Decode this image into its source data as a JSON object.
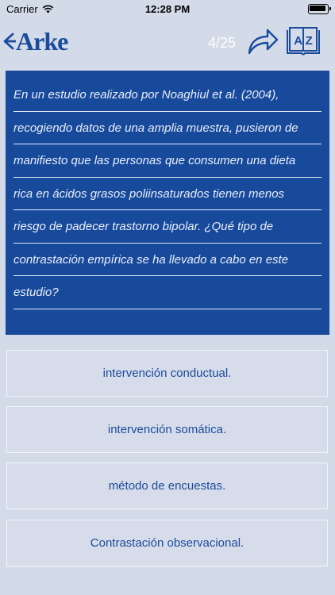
{
  "status_bar": {
    "carrier": "Carrier",
    "time": "12:28 PM"
  },
  "header": {
    "logo_text": "Arke",
    "counter": "4/25",
    "dictionary_icon_text": "A Z"
  },
  "question": {
    "lines": [
      "En un estudio realizado por Noaghiul et al. (2004),",
      "recogiendo datos de una amplia muestra, pusieron de",
      "manifiesto que las personas que consumen una dieta",
      "rica en ácidos grasos poliinsaturados tienen menos",
      "riesgo de padecer trastorno bipolar. ¿Qué tipo de",
      "contrastación empírica se ha llevado a cabo en este",
      "estudio?"
    ]
  },
  "answers": [
    {
      "label": "intervención conductual."
    },
    {
      "label": "intervención somática."
    },
    {
      "label": "método de encuestas."
    },
    {
      "label": "Contrastación observacional."
    }
  ],
  "colors": {
    "background": "#d3dae8",
    "accent": "#184a9c",
    "answer_text": "#1c4b9a"
  },
  "icons": [
    "wifi-icon",
    "battery-icon",
    "back-arrow-icon",
    "share-icon",
    "dictionary-icon"
  ]
}
